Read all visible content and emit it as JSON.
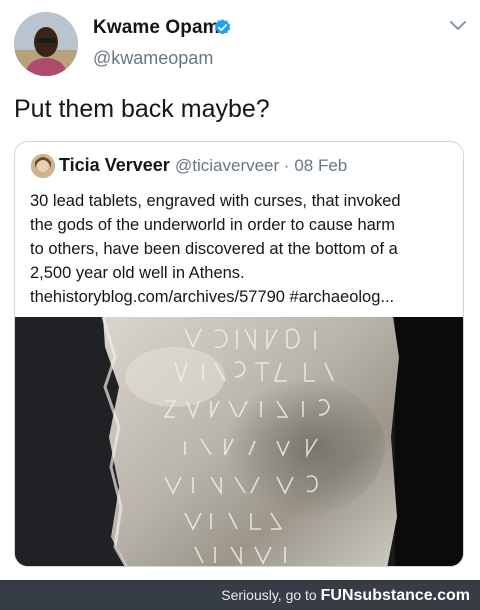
{
  "tweet": {
    "display_name": "Kwame Opam",
    "handle": "@kwameopam",
    "text": "Put them back maybe?",
    "icons": {
      "verified": "verified-badge-icon",
      "menu": "chevron-down-icon"
    },
    "colors": {
      "verified": "#1da1f2",
      "secondary_text": "#657786"
    }
  },
  "quoted_tweet": {
    "display_name": "Ticia Verveer",
    "handle": "@ticiaverveer",
    "date": "08 Feb",
    "separator": "·",
    "lines": [
      "30 lead tablets, engraved with curses, that invoked",
      "the gods of the underworld in order to cause harm",
      "to others, have been discovered at the bottom of a",
      "2,500 year old well in Athens.",
      "thehistoryblog.com/archives/57790 #archaeolog..."
    ]
  },
  "footer": {
    "prefix": "Seriously, go to",
    "brand_fun": "FUN",
    "brand_rest": "substance.com",
    "colors": {
      "bar": "#373d45"
    }
  }
}
